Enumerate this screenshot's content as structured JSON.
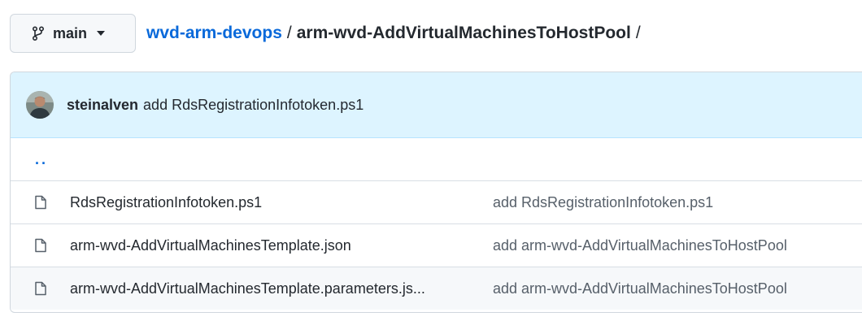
{
  "branch": {
    "name": "main",
    "icon": "git-branch-icon"
  },
  "breadcrumb": {
    "repo": "wvd-arm-devops",
    "separator": "/",
    "current": "arm-wvd-AddVirtualMachinesToHostPool",
    "trailing": "/"
  },
  "latest_commit": {
    "author": "steinalven",
    "message": "add RdsRegistrationInfotoken.ps1"
  },
  "parent_dir": "..",
  "files": [
    {
      "name": "RdsRegistrationInfotoken.ps1",
      "commit": "add RdsRegistrationInfotoken.ps1",
      "icon": "file-icon"
    },
    {
      "name": "arm-wvd-AddVirtualMachinesTemplate.json",
      "commit": "add arm-wvd-AddVirtualMachinesToHostPool",
      "icon": "file-icon"
    },
    {
      "name": "arm-wvd-AddVirtualMachinesTemplate.parameters.js...",
      "commit": "add arm-wvd-AddVirtualMachinesToHostPool",
      "icon": "file-icon"
    }
  ],
  "colors": {
    "link": "#0969da",
    "header_bg": "#ddf4ff",
    "border": "#d0d7de"
  }
}
